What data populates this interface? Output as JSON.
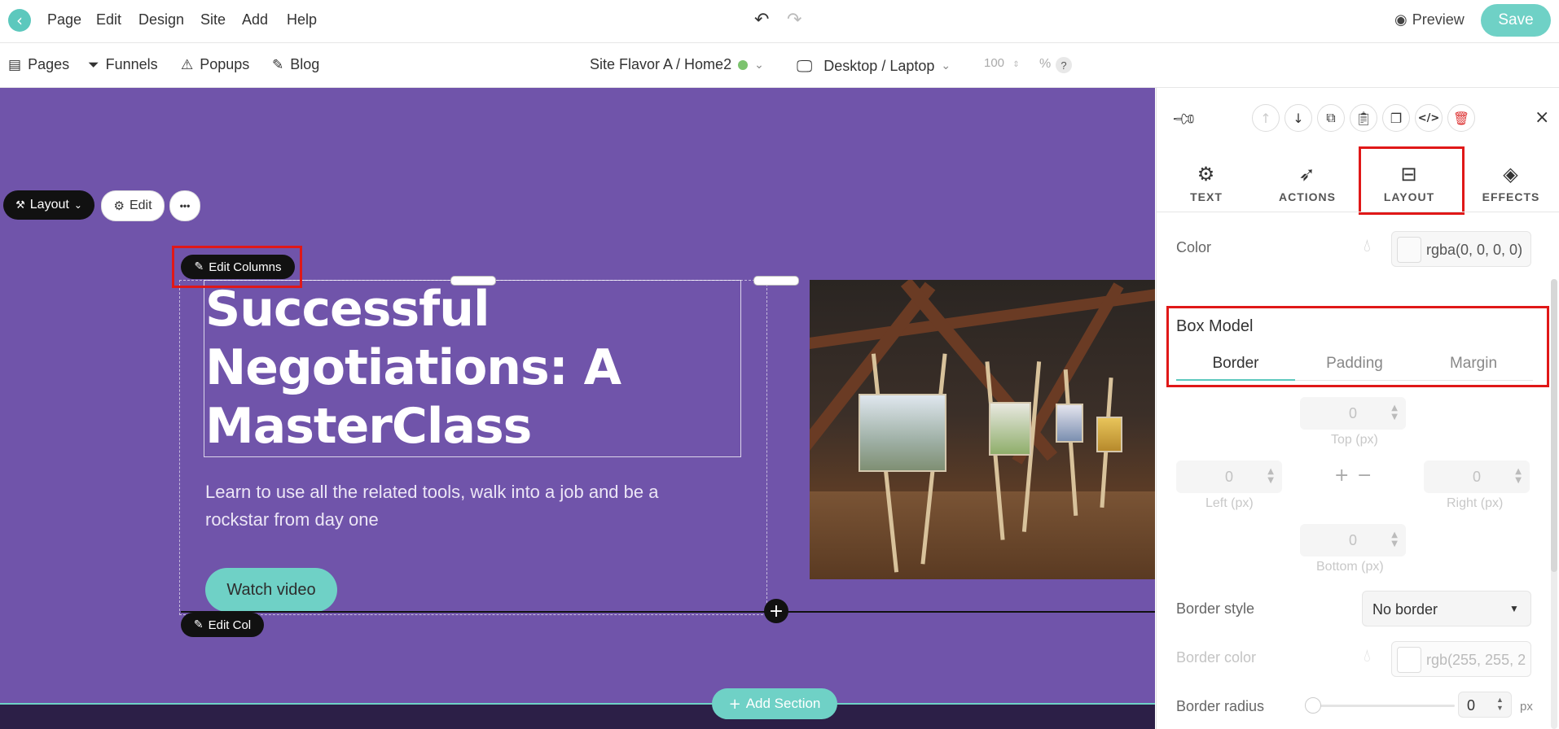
{
  "topbar": {
    "menu": [
      "Page",
      "Edit",
      "Design",
      "Site",
      "Add",
      "Help"
    ],
    "preview_label": "Preview",
    "save_label": "Save"
  },
  "subbar": {
    "pages_label": "Pages",
    "funnels_label": "Funnels",
    "popups_label": "Popups",
    "blog_label": "Blog",
    "site_label": "Site Flavor A / Home2",
    "device_label": "Desktop / Laptop",
    "zoom_value": "100",
    "zoom_unit": "%",
    "help_label": "?"
  },
  "canvas": {
    "layout_label": "Layout",
    "edit_label": "Edit",
    "more_label": "•••",
    "edit_columns_label": "Edit Columns",
    "edit_col_label": "Edit Col",
    "hero_title": "Successful Negotiations: A MasterClass",
    "hero_subtitle": "Learn to use all the related tools, walk into a job and be a rockstar from day one",
    "watch_video_label": "Watch video",
    "add_section_label": "Add Section"
  },
  "panel": {
    "tabs": [
      {
        "label": "TEXT",
        "icon": "gear-icon"
      },
      {
        "label": "ACTIONS",
        "icon": "cursor-click-icon"
      },
      {
        "label": "LAYOUT",
        "icon": "layout-icon"
      },
      {
        "label": "EFFECTS",
        "icon": "layers-icon"
      }
    ],
    "active_tab": "LAYOUT",
    "color_label": "Color",
    "color_value": "rgba(0, 0, 0, 0)",
    "box_model_title": "Box Model",
    "box_tabs": [
      "Border",
      "Padding",
      "Margin"
    ],
    "active_box_tab": "Border",
    "top_value": "0",
    "top_label": "Top (px)",
    "left_value": "0",
    "left_label": "Left (px)",
    "right_value": "0",
    "right_label": "Right (px)",
    "bottom_value": "0",
    "bottom_label": "Bottom (px)",
    "border_style_label": "Border style",
    "border_style_value": "No border",
    "border_color_label": "Border color",
    "border_color_value": "rgb(255, 255, 2",
    "border_radius_label": "Border radius",
    "border_radius_value": "0",
    "border_radius_unit": "px"
  },
  "colors": {
    "accent": "#6fd1c6",
    "canvas_bg": "#7054aa",
    "highlight": "#e01818"
  }
}
